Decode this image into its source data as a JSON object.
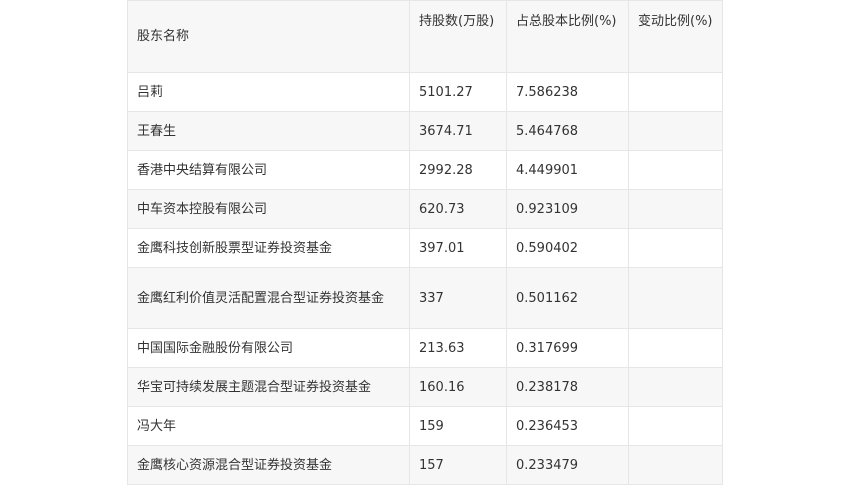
{
  "table": {
    "headers": {
      "name": "股东名称",
      "shares": "持股数(万股)",
      "ratio": "占总股本比例(%)",
      "change": "变动比例(%)"
    },
    "rows": [
      {
        "name": "吕莉",
        "shares": "5101.27",
        "ratio": "7.586238",
        "change": ""
      },
      {
        "name": "王春生",
        "shares": "3674.71",
        "ratio": "5.464768",
        "change": ""
      },
      {
        "name": "香港中央结算有限公司",
        "shares": "2992.28",
        "ratio": "4.449901",
        "change": ""
      },
      {
        "name": "中车资本控股有限公司",
        "shares": "620.73",
        "ratio": "0.923109",
        "change": ""
      },
      {
        "name": "金鹰科技创新股票型证券投资基金",
        "shares": "397.01",
        "ratio": "0.590402",
        "change": ""
      },
      {
        "name": "金鹰红利价值灵活配置混合型证券投资基金",
        "shares": "337",
        "ratio": "0.501162",
        "change": ""
      },
      {
        "name": "中国国际金融股份有限公司",
        "shares": "213.63",
        "ratio": "0.317699",
        "change": ""
      },
      {
        "name": "华宝可持续发展主题混合型证券投资基金",
        "shares": "160.16",
        "ratio": "0.238178",
        "change": ""
      },
      {
        "name": "冯大年",
        "shares": "159",
        "ratio": "0.236453",
        "change": ""
      },
      {
        "name": "金鹰核心资源混合型证券投资基金",
        "shares": "157",
        "ratio": "0.233479",
        "change": ""
      }
    ]
  }
}
